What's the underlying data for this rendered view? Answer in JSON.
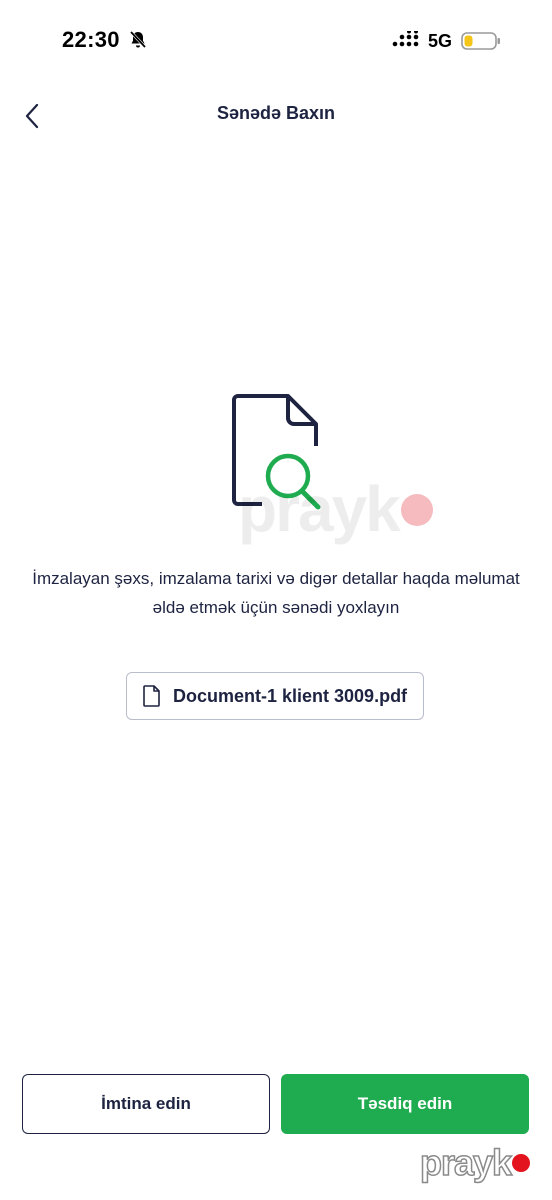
{
  "status_bar": {
    "time": "22:30",
    "network": "5G",
    "icons": [
      "bell-off-icon",
      "signal-icon",
      "battery-icon"
    ]
  },
  "header": {
    "title": "Sənədə Baxın",
    "back_icon": "chevron-left-icon"
  },
  "main": {
    "illustration_icon": "document-search-icon",
    "description": "İmzalayan şəxs, imzalama tarixi və digər detallar haqda məlumat əldə etmək üçün sənədi yoxlayın",
    "file": {
      "icon": "file-icon",
      "name": "Document-1 klient 3009.pdf"
    }
  },
  "actions": {
    "cancel_label": "İmtina edin",
    "confirm_label": "Təsdiq edin"
  },
  "watermark": {
    "text": "prayk"
  },
  "colors": {
    "primary_text": "#1d2340",
    "accent_green": "#1fab4f",
    "border": "#b9bccb",
    "battery_fill": "#f5c518"
  }
}
